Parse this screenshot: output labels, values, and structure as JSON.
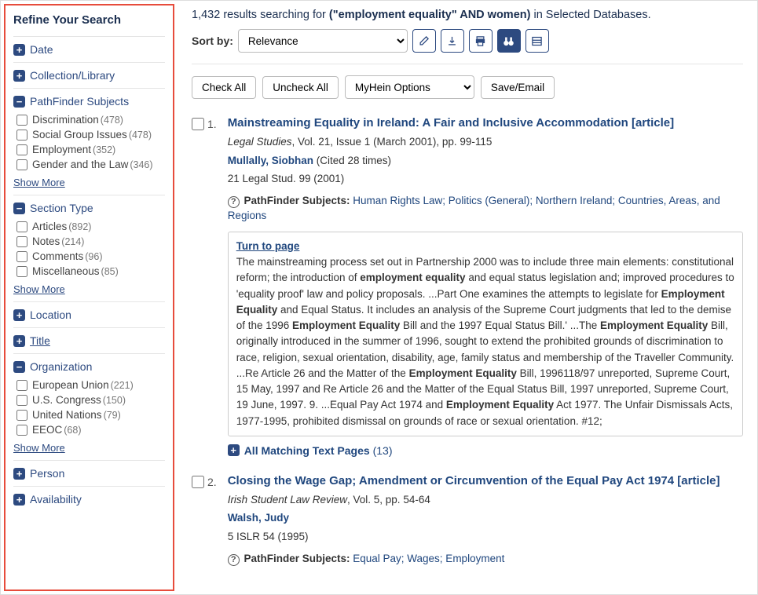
{
  "sidebar": {
    "title": "Refine Your Search",
    "show_more": "Show More",
    "facets": {
      "date": "Date",
      "collection": "Collection/Library",
      "pathfinder": "PathFinder Subjects",
      "section": "Section Type",
      "location": "Location",
      "title": "Title",
      "organization": "Organization",
      "person": "Person",
      "availability": "Availability"
    },
    "pathfinder_items": [
      {
        "label": "Discrimination",
        "count": "(478)"
      },
      {
        "label": "Social Group Issues",
        "count": "(478)"
      },
      {
        "label": "Employment",
        "count": "(352)"
      },
      {
        "label": "Gender and the Law",
        "count": "(346)"
      }
    ],
    "section_items": [
      {
        "label": "Articles",
        "count": "(892)"
      },
      {
        "label": "Notes",
        "count": "(214)"
      },
      {
        "label": "Comments",
        "count": "(96)"
      },
      {
        "label": "Miscellaneous",
        "count": "(85)"
      }
    ],
    "org_items": [
      {
        "label": "European Union",
        "count": "(221)"
      },
      {
        "label": "U.S. Congress",
        "count": "(150)"
      },
      {
        "label": "United Nations",
        "count": "(79)"
      },
      {
        "label": "EEOC",
        "count": "(68)"
      }
    ]
  },
  "header": {
    "count": "1,432",
    "prefix": "results searching for",
    "query": "(\"employment equality\" AND women)",
    "suffix": "in Selected Databases."
  },
  "sort": {
    "label": "Sort by:",
    "selected": "Relevance"
  },
  "actions": {
    "check_all": "Check All",
    "uncheck_all": "Uncheck All",
    "myhein": "MyHein Options",
    "save": "Save/Email"
  },
  "result1": {
    "num": "1.",
    "title": "Mainstreaming Equality in Ireland: A Fair and Inclusive Accommodation [article]",
    "journal": "Legal Studies",
    "journal_rest": ", Vol. 21, Issue 1 (March 2001), pp. 99-115",
    "author": "Mullally, Siobhan",
    "cited": "(Cited 28 times)",
    "citation": "21 Legal Stud. 99 (2001)",
    "pf_label": "PathFinder Subjects:",
    "pf_links": "Human Rights Law; Politics (General); Northern Ireland; Countries, Areas, and Regions",
    "turn": "Turn to page",
    "snippet_parts": {
      "s1": "The mainstreaming process set out in Partnership 2000 was to include three main elements: constitutional reform; the introduction of ",
      "b1": "employment equality",
      "s2": " and equal status legislation and; improved procedures to 'equality proof' law and policy proposals. ...Part One examines the attempts to legislate for ",
      "b2": "Employment Equality",
      "s3": " and Equal Status. It includes an analysis of the Supreme Court judgments that led to the demise of the 1996 ",
      "b3": "Employment Equality",
      "s4": " Bill and the 1997 Equal Status Bill.' ...The ",
      "b4": "Employment Equality",
      "s5": " Bill, originally introduced in the summer of 1996, sought to extend the prohibited grounds of discrimination to race, religion, sexual orientation, disability, age, family status and membership of the Traveller Community. ...Re Article 26 and the Matter of the ",
      "b5": "Employment Equality",
      "s6": " Bill, 1996118/97 unreported, Supreme Court, 15 May, 1997 and Re Article 26 and the Matter of the Equal Status Bill, 1997 unreported, Supreme Court, 19 June, 1997. 9. ...Equal Pay Act 1974 and ",
      "b6": "Employment Equality",
      "s7": " Act 1977. The Unfair Dismissals Acts, 1977-1995, prohibited dismissal on grounds of race or sexual orientation. #12;"
    },
    "match_prefix": " All Matching Text Pages",
    "match_count": "(13)"
  },
  "result2": {
    "num": "2.",
    "title": "Closing the Wage Gap; Amendment or Circumvention of the Equal Pay Act 1974 [article]",
    "journal": "Irish Student Law Review",
    "journal_rest": ", Vol. 5, pp. 54-64",
    "author": "Walsh, Judy",
    "citation": "5 ISLR 54 (1995)",
    "pf_label": "PathFinder Subjects:",
    "pf_links": "Equal Pay; Wages; Employment"
  }
}
